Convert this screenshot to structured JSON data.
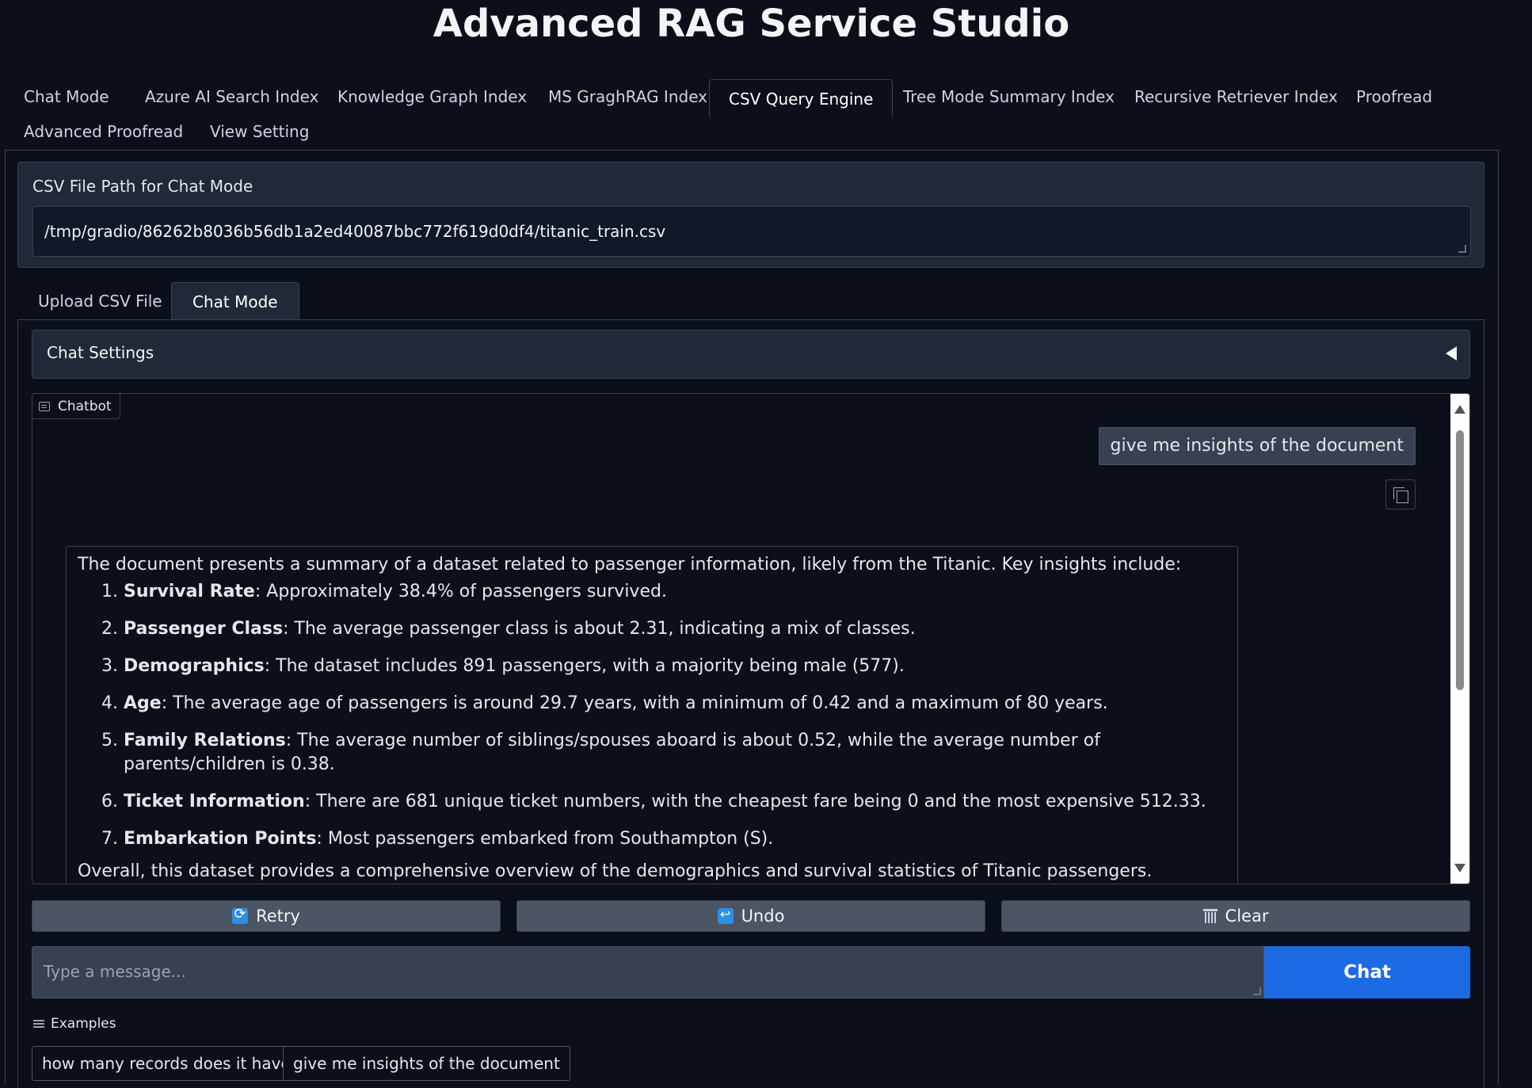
{
  "app": {
    "title": "Advanced RAG Service Studio"
  },
  "main_tabs": [
    {
      "label": "Chat Mode"
    },
    {
      "label": "Azure AI Search Index"
    },
    {
      "label": "Knowledge Graph Index"
    },
    {
      "label": "MS GraghRAG Index"
    },
    {
      "label": "CSV Query Engine",
      "active": true
    },
    {
      "label": "Tree Mode Summary Index"
    },
    {
      "label": "Recursive Retriever Index"
    },
    {
      "label": "Proofread"
    },
    {
      "label": "Advanced Proofread"
    },
    {
      "label": "View Setting"
    }
  ],
  "csv_path": {
    "label": "CSV File Path for Chat Mode",
    "value": "/tmp/gradio/86262b8036b56db1a2ed40087bbc772f619d0df4/titanic_train.csv"
  },
  "sub_tabs": [
    {
      "label": "Upload CSV File"
    },
    {
      "label": "Chat Mode",
      "active": true
    }
  ],
  "chat_settings": {
    "label": "Chat Settings",
    "icon": "caret-left-icon"
  },
  "chatbot": {
    "label": "Chatbot",
    "user_message": "give me insights of the document",
    "bot_message": {
      "intro": "The document presents a summary of a dataset related to passenger information, likely from the Titanic. Key insights include:",
      "items": [
        {
          "title": "Survival Rate",
          "text": ": Approximately 38.4% of passengers survived."
        },
        {
          "title": "Passenger Class",
          "text": ": The average passenger class is about 2.31, indicating a mix of classes."
        },
        {
          "title": "Demographics",
          "text": ": The dataset includes 891 passengers, with a majority being male (577)."
        },
        {
          "title": "Age",
          "text": ": The average age of passengers is around 29.7 years, with a minimum of 0.42 and a maximum of 80 years."
        },
        {
          "title": "Family Relations",
          "text": ": The average number of siblings/spouses aboard is about 0.52, while the average number of parents/children is 0.38."
        },
        {
          "title": "Ticket Information",
          "text": ": There are 681 unique ticket numbers, with the cheapest fare being 0 and the most expensive 512.33."
        },
        {
          "title": "Embarkation Points",
          "text": ": Most passengers embarked from Southampton (S)."
        }
      ],
      "summary": "Overall, this dataset provides a comprehensive overview of the demographics and survival statistics of Titanic passengers."
    }
  },
  "actions": {
    "retry": "Retry",
    "undo": "Undo",
    "clear": "Clear"
  },
  "message_input": {
    "placeholder": "Type a message..."
  },
  "chat_button": "Chat",
  "examples": {
    "label": "Examples",
    "items": [
      "how many records does it have",
      "give me insights of the document"
    ]
  },
  "colors": {
    "background": "#0b0f19",
    "panel": "#1f2937",
    "accent": "#1d6ae5",
    "button": "#4b5563"
  }
}
